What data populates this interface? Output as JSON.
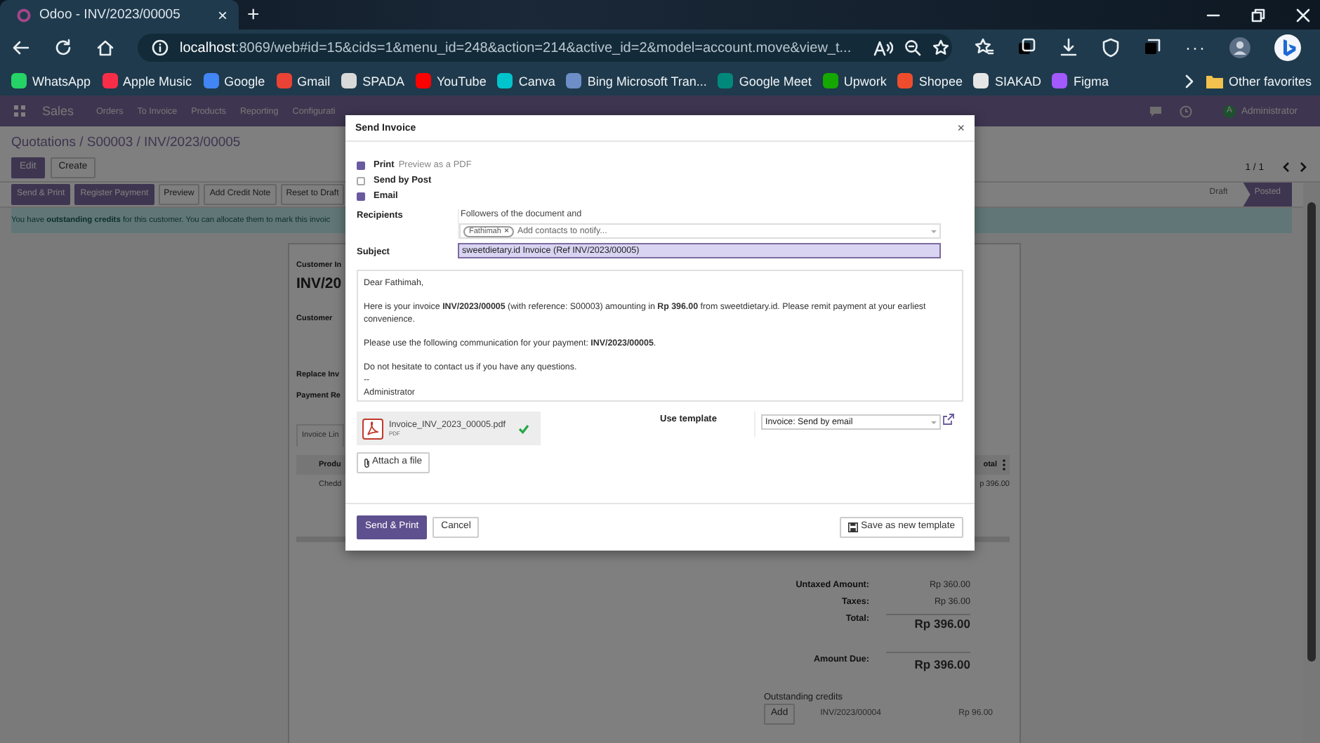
{
  "browser": {
    "tab": {
      "title": "Odoo - INV/2023/00005",
      "close": "×",
      "selected": true
    },
    "new_tab": "+",
    "url": {
      "host": "localhost",
      "rest": ":8069/web#id=15&cids=1&menu_id=248&action=214&active_id=2&model=account.move&view_t..."
    },
    "more": "···",
    "bookmarks": [
      {
        "label": "WhatsApp",
        "color": "#25d366"
      },
      {
        "label": "Apple Music",
        "color": "#fa2d48"
      },
      {
        "label": "Google",
        "color": "#4285f4"
      },
      {
        "label": "Gmail",
        "color": "#ea4335"
      },
      {
        "label": "SPADA",
        "color": "#d9d9d9"
      },
      {
        "label": "YouTube",
        "color": "#ff0000"
      },
      {
        "label": "Canva",
        "color": "#00c4cc"
      },
      {
        "label": "Bing Microsoft Tran...",
        "color": "#6d8ec7"
      },
      {
        "label": "Google Meet",
        "color": "#00897b"
      },
      {
        "label": "Upwork",
        "color": "#14a800"
      },
      {
        "label": "Shopee",
        "color": "#ee4d2d"
      },
      {
        "label": "SIAKAD",
        "color": "#e6e6e6"
      },
      {
        "label": "Figma",
        "color": "#a259ff"
      }
    ],
    "other_favorites": "Other favorites"
  },
  "navbar": {
    "app": "Sales",
    "menu": [
      "Orders",
      "To Invoice",
      "Products",
      "Reporting",
      "Configurati"
    ],
    "user": {
      "initial": "A",
      "name": "Administrator"
    }
  },
  "breadcrumb": "Quotations / S00003 / INV/2023/00005",
  "form_buttons": [
    {
      "label": "Edit",
      "primary": true
    },
    {
      "label": "Create",
      "primary": false
    }
  ],
  "pager": "1 / 1",
  "header_buttons": [
    {
      "label": "Send & Print",
      "primary": true
    },
    {
      "label": "Register Payment",
      "primary": true
    },
    {
      "label": "Preview",
      "primary": false
    },
    {
      "label": "Add Credit Note",
      "primary": false
    },
    {
      "label": "Reset to Draft",
      "primary": false
    }
  ],
  "stages": [
    {
      "label": "Draft",
      "selected": false
    },
    {
      "label": "Posted",
      "selected": true
    }
  ],
  "alert": "You have **outstanding credits** for this customer. You can allocate them to mark this invoic",
  "sheet": {
    "title_label": "Customer In",
    "title": "INV/20",
    "fields": [
      "Customer",
      "Replace Inv",
      "Payment Re"
    ],
    "tab": "Invoice Lin",
    "columns": {
      "left": "Produ",
      "right": "otal"
    },
    "rows": [
      {
        "left": "Chedd",
        "right": "p 396.00"
      }
    ]
  },
  "totals": [
    {
      "label": "Untaxed Amount:",
      "value": "Rp 360.00",
      "kind": "subtotal"
    },
    {
      "label": "Taxes:",
      "value": "Rp 36.00",
      "kind": "subtotal"
    },
    {
      "label": "Total:",
      "value": "Rp 396.00",
      "kind": "total"
    },
    {
      "label": "Amount Due:",
      "value": "Rp 396.00",
      "kind": "due"
    }
  ],
  "outstanding": {
    "title": "Outstanding credits",
    "lines": [
      {
        "action": "Add",
        "reference": "INV/2023/00004",
        "amount": "Rp 96.00"
      }
    ]
  },
  "dialog": {
    "title": "Send Invoice",
    "close": "×",
    "options": [
      {
        "label": "Print",
        "hint": "Preview as a PDF",
        "checked": true
      },
      {
        "label": "Send by Post",
        "checked": false
      },
      {
        "label": "Email",
        "checked": true
      }
    ],
    "recipients": {
      "label": "Recipients",
      "intro": "Followers of the document and",
      "tags": [
        {
          "name": "Fathimah",
          "remove": "×"
        }
      ],
      "placeholder": "Add contacts to notify..."
    },
    "subject": {
      "label": "Subject",
      "value": "sweetdietary.id Invoice (Ref INV/2023/00005)"
    },
    "body": [
      [
        "Dear Fathimah,"
      ],
      [
        "Here is your invoice **INV/2023/00005** (with reference: S00003) amounting in **Rp 396.00** from sweetdietary.id. Please remit payment at your earliest convenience."
      ],
      [
        "Please use the following communication for your payment: **INV/2023/00005**."
      ],
      [
        "Do not hesitate to contact us if you have any questions.",
        "--",
        "Administrator"
      ]
    ],
    "attachments": [
      {
        "name": "Invoice_INV_2023_00005.pdf",
        "type": "PDF",
        "uploaded": true
      }
    ],
    "attach_button": "Attach a file",
    "template": {
      "label": "Use template",
      "value": "Invoice: Send by email"
    },
    "buttons": [
      {
        "label": "Send & Print",
        "primary": true
      },
      {
        "label": "Cancel",
        "primary": false
      }
    ],
    "save_template": "Save as new template"
  }
}
